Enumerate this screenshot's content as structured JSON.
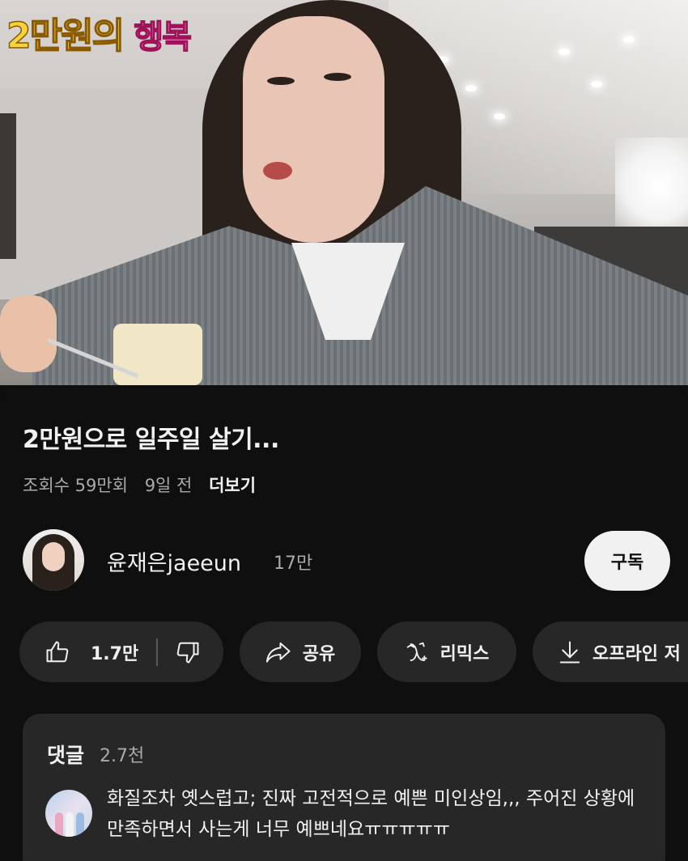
{
  "video": {
    "overlay_text_part1": "2만원의",
    "overlay_text_part2": "행복"
  },
  "title": "2만원으로 일주일 살기...",
  "meta": {
    "views": "조회수 59만회",
    "age": "9일 전",
    "more": "더보기"
  },
  "channel": {
    "name": "윤재은jaeeun",
    "subscribers": "17만",
    "subscribe_label": "구독"
  },
  "actions": {
    "like_count": "1.7만",
    "share_label": "공유",
    "remix_label": "리믹스",
    "download_label": "오프라인 저"
  },
  "comments": {
    "header": "댓글",
    "count": "2.7천",
    "top_comment": "화질조차 옛스럽고; 진짜 고전적으로 예쁜 미인상임,,, 주어진 상황에 만족하면서 사는게 너무 예쁘네요ㅠㅠㅠㅠㅠ"
  },
  "colors": {
    "background": "#0f0f0f",
    "pill": "#272727",
    "text_primary": "#f1f1f1",
    "text_secondary": "#aaaaaa",
    "subscribe_bg": "#f1f1f1"
  },
  "icons": [
    "thumbs-up-icon",
    "thumbs-down-icon",
    "share-icon",
    "remix-icon",
    "download-icon"
  ]
}
